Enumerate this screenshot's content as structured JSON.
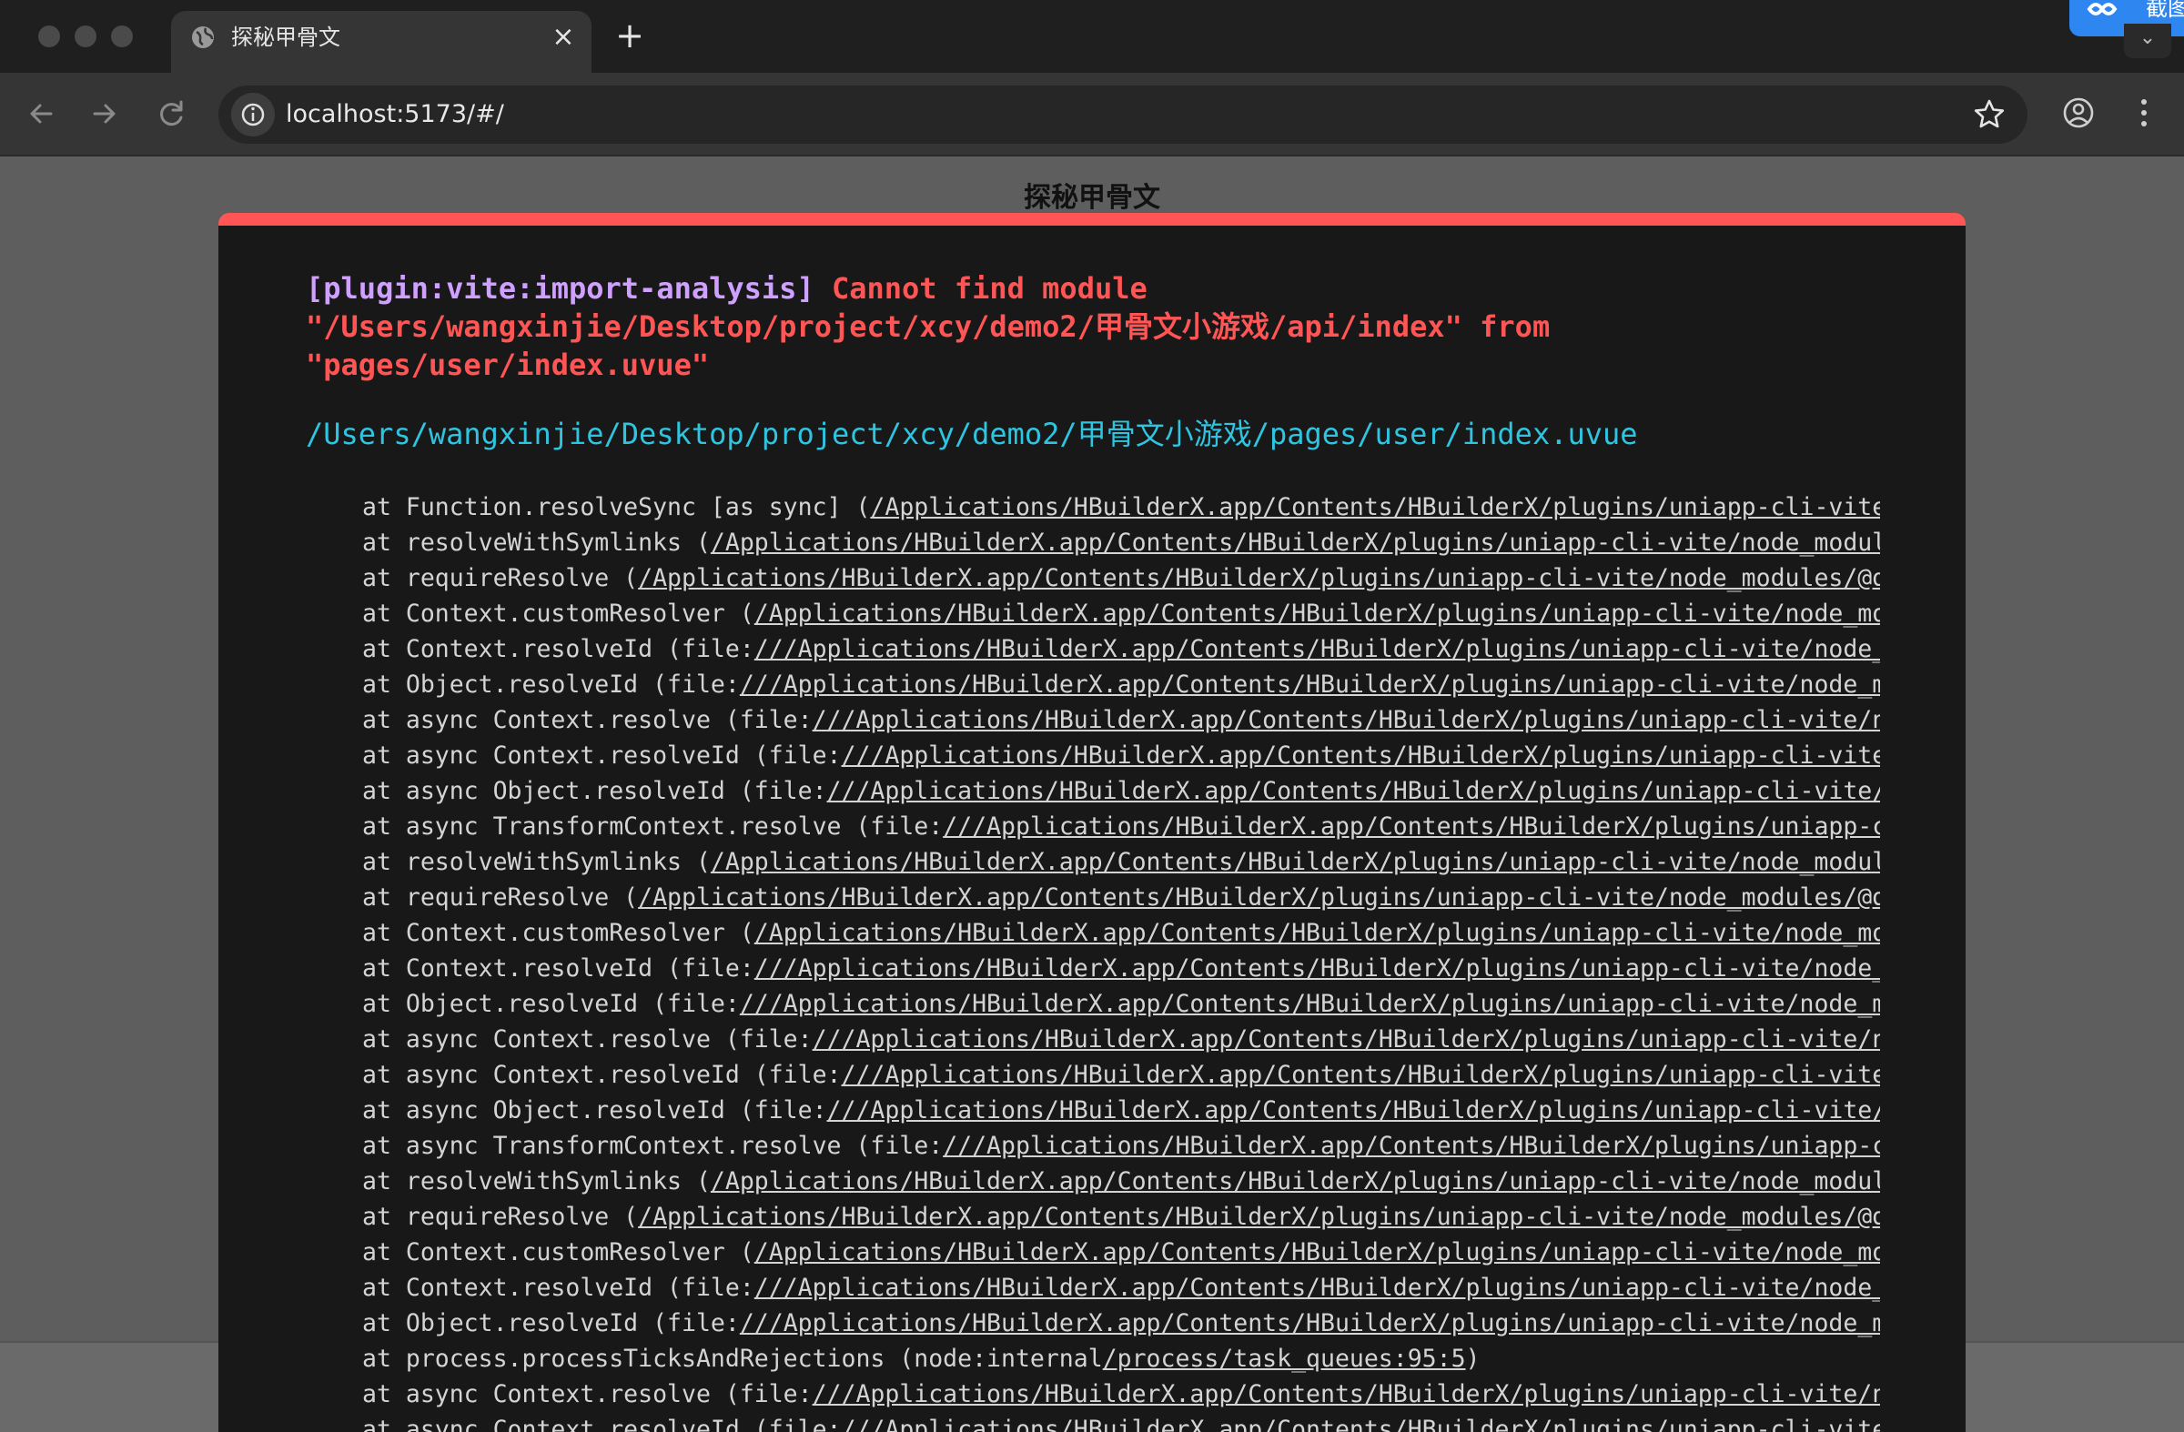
{
  "browser": {
    "tab_title": "探秘甲骨文",
    "tab_close": "×",
    "new_tab": "+",
    "url": "localhost:5173/#/",
    "extension_label": "截图"
  },
  "page": {
    "title": "探秘甲骨文"
  },
  "error_overlay": {
    "accent_color": "#ff5555",
    "plugin": "[plugin:vite:import-analysis]",
    "message_lines": [
      " Cannot find module",
      "\"/Users/wangxinjie/Desktop/project/xcy/demo2/甲骨文小游戏/api/index\" from",
      "\"pages/user/index.uvue\""
    ],
    "file": "/Users/wangxinjie/Desktop/project/xcy/demo2/甲骨文小游戏/pages/user/index.uvue",
    "stack": [
      {
        "prefix": "at Function.resolveSync [as sync] (",
        "loc": "/Applications/HBuilderX.app/Contents/HBuilderX/plugins/uniapp-cli-vite/node_modules/"
      },
      {
        "prefix": "at resolveWithSymlinks (",
        "loc": "/Applications/HBuilderX.app/Contents/HBuilderX/plugins/uniapp-cli-vite/node_modules/"
      },
      {
        "prefix": "at requireResolve (",
        "loc": "/Applications/HBuilderX.app/Contents/HBuilderX/plugins/uniapp-cli-vite/node_modules/@dcloudio/"
      },
      {
        "prefix": "at Context.customResolver (",
        "loc": "/Applications/HBuilderX.app/Contents/HBuilderX/plugins/uniapp-cli-vite/node_modules/"
      },
      {
        "prefix": "at Context.resolveId (file:",
        "loc": "///Applications/HBuilderX.app/Contents/HBuilderX/plugins/uniapp-cli-vite/node_modules/"
      },
      {
        "prefix": "at Object.resolveId (file:",
        "loc": "///Applications/HBuilderX.app/Contents/HBuilderX/plugins/uniapp-cli-vite/node_modules/"
      },
      {
        "prefix": "at async Context.resolve (file:",
        "loc": "///Applications/HBuilderX.app/Contents/HBuilderX/plugins/uniapp-cli-vite/node_modules/"
      },
      {
        "prefix": "at async Context.resolveId (file:",
        "loc": "///Applications/HBuilderX.app/Contents/HBuilderX/plugins/uniapp-cli-vite/node_modules/"
      },
      {
        "prefix": "at async Object.resolveId (file:",
        "loc": "///Applications/HBuilderX.app/Contents/HBuilderX/plugins/uniapp-cli-vite/node_modules/"
      },
      {
        "prefix": "at async TransformContext.resolve (file:",
        "loc": "///Applications/HBuilderX.app/Contents/HBuilderX/plugins/uniapp-cli-vite/node_modules/"
      },
      {
        "prefix": "at resolveWithSymlinks (",
        "loc": "/Applications/HBuilderX.app/Contents/HBuilderX/plugins/uniapp-cli-vite/node_modules/"
      },
      {
        "prefix": "at requireResolve (",
        "loc": "/Applications/HBuilderX.app/Contents/HBuilderX/plugins/uniapp-cli-vite/node_modules/@dcloudio/"
      },
      {
        "prefix": "at Context.customResolver (",
        "loc": "/Applications/HBuilderX.app/Contents/HBuilderX/plugins/uniapp-cli-vite/node_modules/"
      },
      {
        "prefix": "at Context.resolveId (file:",
        "loc": "///Applications/HBuilderX.app/Contents/HBuilderX/plugins/uniapp-cli-vite/node_modules/"
      },
      {
        "prefix": "at Object.resolveId (file:",
        "loc": "///Applications/HBuilderX.app/Contents/HBuilderX/plugins/uniapp-cli-vite/node_modules/"
      },
      {
        "prefix": "at async Context.resolve (file:",
        "loc": "///Applications/HBuilderX.app/Contents/HBuilderX/plugins/uniapp-cli-vite/node_modules/"
      },
      {
        "prefix": "at async Context.resolveId (file:",
        "loc": "///Applications/HBuilderX.app/Contents/HBuilderX/plugins/uniapp-cli-vite/node_modules/"
      },
      {
        "prefix": "at async Object.resolveId (file:",
        "loc": "///Applications/HBuilderX.app/Contents/HBuilderX/plugins/uniapp-cli-vite/node_modules/"
      },
      {
        "prefix": "at async TransformContext.resolve (file:",
        "loc": "///Applications/HBuilderX.app/Contents/HBuilderX/plugins/uniapp-cli-vite/node_modules/"
      },
      {
        "prefix": "at resolveWithSymlinks (",
        "loc": "/Applications/HBuilderX.app/Contents/HBuilderX/plugins/uniapp-cli-vite/node_modules/"
      },
      {
        "prefix": "at requireResolve (",
        "loc": "/Applications/HBuilderX.app/Contents/HBuilderX/plugins/uniapp-cli-vite/node_modules/@dcloudio/"
      },
      {
        "prefix": "at Context.customResolver (",
        "loc": "/Applications/HBuilderX.app/Contents/HBuilderX/plugins/uniapp-cli-vite/node_modules/"
      },
      {
        "prefix": "at Context.resolveId (file:",
        "loc": "///Applications/HBuilderX.app/Contents/HBuilderX/plugins/uniapp-cli-vite/node_modules/"
      },
      {
        "prefix": "at Object.resolveId (file:",
        "loc": "///Applications/HBuilderX.app/Contents/HBuilderX/plugins/uniapp-cli-vite/node_modules/"
      },
      {
        "prefix": "at process.processTicksAndRejections (node:internal",
        "loc": "/process/task_queues:95:5",
        "suffix": ")"
      },
      {
        "prefix": "at async Context.resolve (file:",
        "loc": "///Applications/HBuilderX.app/Contents/HBuilderX/plugins/uniapp-cli-vite/node_modules/"
      },
      {
        "prefix": "at async Context.resolveId (file:",
        "loc": "///Applications/HBuilderX.app/Contents/HBuilderX/plugins/uniapp-cli-vite/node_modules/"
      }
    ]
  }
}
